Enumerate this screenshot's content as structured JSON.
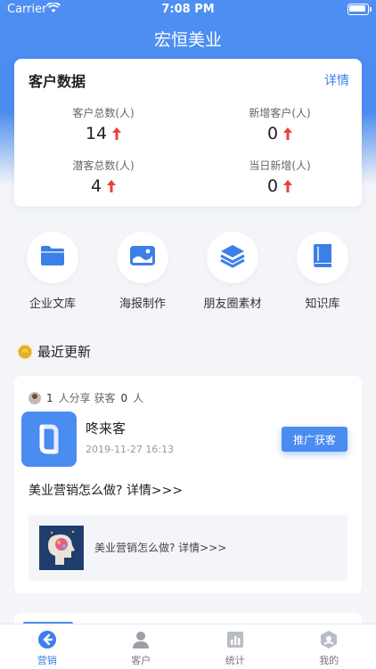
{
  "status": {
    "carrier": "Carrier",
    "time": "7:08 PM"
  },
  "app_title": "宏恒美业",
  "customer_data": {
    "title": "客户数据",
    "detail_link": "详情",
    "stats": [
      {
        "label": "客户总数(人)",
        "value": "14"
      },
      {
        "label": "新增客户(人)",
        "value": "0"
      },
      {
        "label": "潜客总数(人)",
        "value": "4"
      },
      {
        "label": "当日新增(人)",
        "value": "0"
      }
    ]
  },
  "quick_actions": [
    {
      "label": "企业文库",
      "icon": "folder-icon"
    },
    {
      "label": "海报制作",
      "icon": "poster-icon"
    },
    {
      "label": "朋友圈素材",
      "icon": "layers-icon"
    },
    {
      "label": "知识库",
      "icon": "book-icon"
    }
  ],
  "recent": {
    "title": "最近更新",
    "share_stats": {
      "count": "1",
      "share_text": "人分享 获客",
      "gained": "0",
      "unit": "人"
    },
    "post": {
      "name": "咚来客",
      "time": "2019-11-27 16:13",
      "promo_button": "推广获客",
      "text": "美业营销怎么做?  详情>>>",
      "link_text": "美业营销怎么做?  详情>>>"
    }
  },
  "tabs": [
    {
      "label": "营销",
      "icon": "marketing-icon",
      "active": true
    },
    {
      "label": "客户",
      "icon": "customer-icon",
      "active": false
    },
    {
      "label": "统计",
      "icon": "stats-icon",
      "active": false
    },
    {
      "label": "我的",
      "icon": "profile-icon",
      "active": false
    }
  ],
  "colors": {
    "primary": "#4a8cf0",
    "up_arrow": "#e8413b",
    "background": "#f3f5f9"
  }
}
